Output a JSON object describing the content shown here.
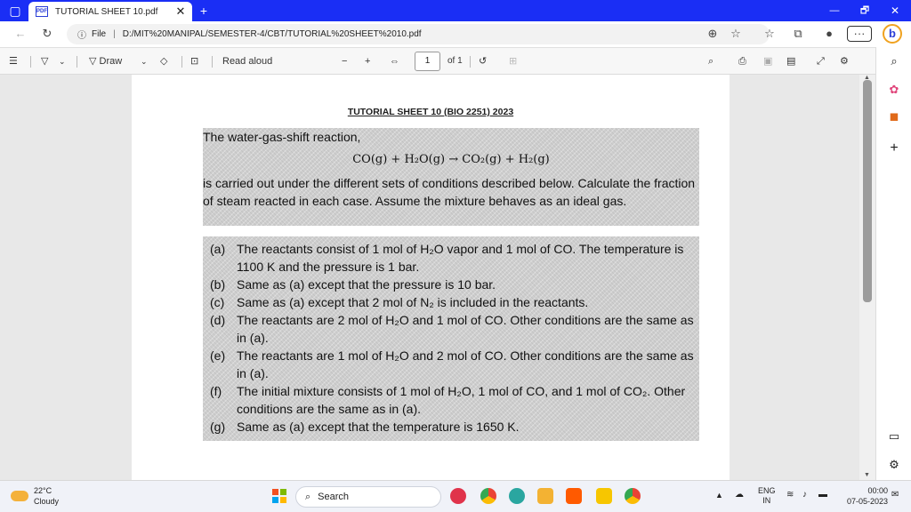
{
  "window": {
    "tab_title": "TUTORIAL SHEET 10.pdf",
    "tab_icon": "pdf-icon",
    "new_tab_symbol": "+",
    "minimize_symbol": "—",
    "restore_symbol": "🗗",
    "close_symbol": "✕"
  },
  "address": {
    "prefix": "File",
    "url": "D:/MIT%20MANIPAL/SEMESTER-4/CBT/TUTORIAL%20SHEET%2010.pdf"
  },
  "toolbar": {
    "draw_label": "Draw",
    "read_aloud_label": "Read aloud",
    "zoom_out": "−",
    "zoom_in": "+",
    "page_current": "1",
    "page_total": "of 1"
  },
  "document": {
    "title": "TUTORIAL SHEET 10 (BIO 2251) 2023",
    "intro": "The water-gas-shift reaction,",
    "equation": "CO(g) + H₂O(g) → CO₂(g) + H₂(g)",
    "question": "is carried out under the different sets of conditions described below. Calculate the fraction of steam reacted in each case. Assume the mixture behaves as an ideal gas.",
    "items": [
      {
        "label": "(a)",
        "text": "The reactants consist of 1 mol of H₂O vapor and 1 mol of CO. The temperature is 1100 K and the pressure is 1 bar."
      },
      {
        "label": "(b)",
        "text": "Same as (a) except that the pressure is 10 bar."
      },
      {
        "label": "(c)",
        "text": "Same as (a) except that 2 mol of N₂ is included in the reactants."
      },
      {
        "label": "(d)",
        "text": "The reactants are 2 mol of H₂O and 1 mol of CO. Other conditions are the same as in (a)."
      },
      {
        "label": "(e)",
        "text": "The reactants are 1 mol of H₂O and 2 mol of CO. Other conditions are the same as in (a)."
      },
      {
        "label": "(f)",
        "text": "The initial mixture consists of 1 mol of H₂O, 1 mol of CO, and 1 mol of CO₂. Other conditions are the same as in (a)."
      },
      {
        "label": "(g)",
        "text": "Same as (a) except that the temperature is 1650 K."
      }
    ]
  },
  "taskbar": {
    "weather_temp": "22°C",
    "weather_desc": "Cloudy",
    "search_label": "Search",
    "lang_top": "ENG",
    "lang_bottom": "IN",
    "time": "00:00",
    "date": "07-05-2023"
  },
  "colors": {
    "titlebar": "#1a2ef5",
    "accent": "#2a3ed8"
  }
}
